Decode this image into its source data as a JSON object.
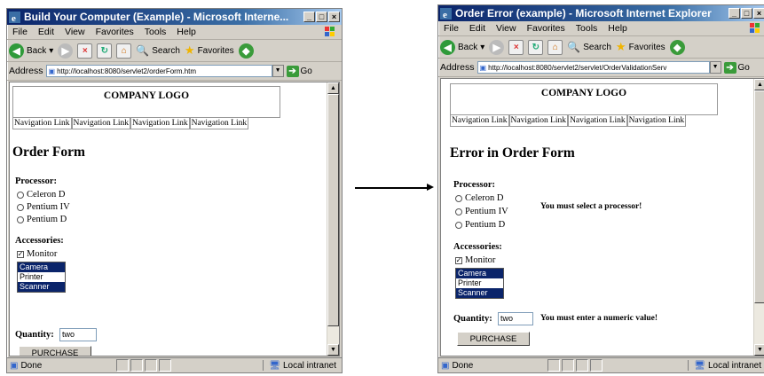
{
  "left": {
    "title": "Build Your Computer (Example) - Microsoft Interne...",
    "menu": [
      "File",
      "Edit",
      "View",
      "Favorites",
      "Tools",
      "Help"
    ],
    "toolbar": {
      "back": "Back",
      "search": "Search",
      "favorites": "Favorites"
    },
    "address": {
      "label": "Address",
      "url": "http://localhost:8080/servlet2/orderForm.htm",
      "go": "Go"
    },
    "page": {
      "logo": "COMPANY LOGO",
      "nav": [
        "Navigation Link",
        "Navigation Link",
        "Navigation Link",
        "Navigation Link"
      ],
      "heading": "Order Form",
      "processor_label": "Processor:",
      "processors": [
        "Celeron D",
        "Pentium IV",
        "Pentium D"
      ],
      "accessories_label": "Accessories:",
      "monitor": "Monitor",
      "list": [
        {
          "label": "Camera",
          "selected": true
        },
        {
          "label": "Printer",
          "selected": false
        },
        {
          "label": "Scanner",
          "selected": true
        }
      ],
      "quantity_label": "Quantity:",
      "quantity_value": "two",
      "purchase": "PURCHASE"
    },
    "status": {
      "text": "Done",
      "zone": "Local intranet"
    }
  },
  "right": {
    "title": "Order Error (example) - Microsoft Internet Explorer",
    "menu": [
      "File",
      "Edit",
      "View",
      "Favorites",
      "Tools",
      "Help"
    ],
    "toolbar": {
      "back": "Back",
      "search": "Search",
      "favorites": "Favorites"
    },
    "address": {
      "label": "Address",
      "url": "http://localhost:8080/servlet2/servlet/OrderValidationServ",
      "go": "Go"
    },
    "page": {
      "logo": "COMPANY LOGO",
      "nav": [
        "Navigation Link",
        "Navigation Link",
        "Navigation Link",
        "Navigation Link"
      ],
      "heading": "Error in Order Form",
      "processor_label": "Processor:",
      "processors": [
        "Celeron D",
        "Pentium IV",
        "Pentium D"
      ],
      "processor_error": "You must select a processor!",
      "accessories_label": "Accessories:",
      "monitor": "Monitor",
      "list": [
        {
          "label": "Camera",
          "selected": true
        },
        {
          "label": "Printer",
          "selected": false
        },
        {
          "label": "Scanner",
          "selected": true
        }
      ],
      "quantity_label": "Quantity:",
      "quantity_value": "two",
      "quantity_error": "You must enter a numeric value!",
      "purchase": "PURCHASE"
    },
    "status": {
      "text": "Done",
      "zone": "Local intranet"
    }
  },
  "colors": {
    "titlebar": "#0a246a",
    "selection": "#0a246a",
    "chrome": "#d4d0c8"
  }
}
